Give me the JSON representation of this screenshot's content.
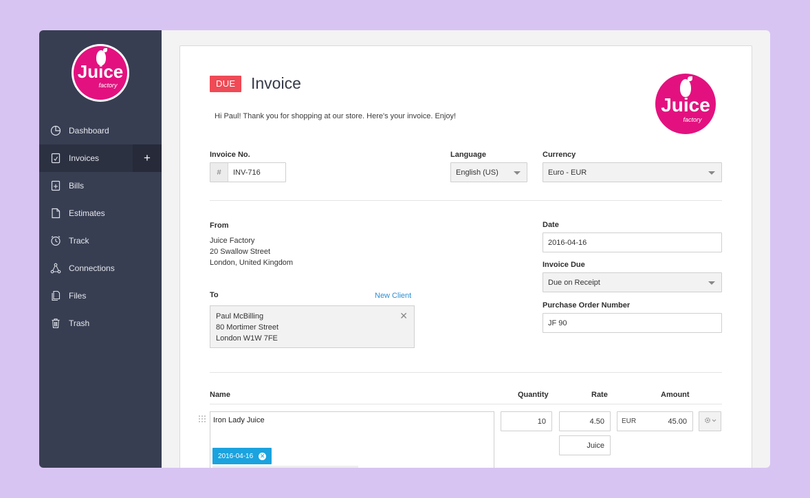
{
  "brand": {
    "logo_word": "Juice",
    "logo_sub": "factory",
    "accent": "#e3117f"
  },
  "sidebar": {
    "items": [
      {
        "label": "Dashboard",
        "icon": "pie-chart-icon"
      },
      {
        "label": "Invoices",
        "icon": "invoice-icon",
        "active": true,
        "action": "+"
      },
      {
        "label": "Bills",
        "icon": "bill-icon"
      },
      {
        "label": "Estimates",
        "icon": "document-icon"
      },
      {
        "label": "Track",
        "icon": "clock-icon"
      },
      {
        "label": "Connections",
        "icon": "connections-icon"
      },
      {
        "label": "Files",
        "icon": "files-icon"
      },
      {
        "label": "Trash",
        "icon": "trash-icon"
      }
    ]
  },
  "invoice": {
    "status": "DUE",
    "title": "Invoice",
    "greeting": "Hi Paul! Thank you for shopping at our store. Here's your invoice. Enjoy!",
    "number_label": "Invoice No.",
    "number_prefix": "#",
    "number": "INV-716",
    "language_label": "Language",
    "language": "English (US)",
    "currency_label": "Currency",
    "currency": "Euro - EUR",
    "from_label": "From",
    "from_lines": [
      "Juice Factory",
      "20 Swallow Street",
      "London, United Kingdom"
    ],
    "to_label": "To",
    "new_client": "New Client",
    "to_lines": [
      "Paul McBilling",
      "80 Mortimer Street",
      "London W1W 7FE"
    ],
    "date_label": "Date",
    "date": "2016-04-16",
    "due_label": "Invoice Due",
    "due": "Due on Receipt",
    "po_label": "Purchase Order Number",
    "po": "JF 90"
  },
  "items_table": {
    "headers": {
      "name": "Name",
      "quantity": "Quantity",
      "rate": "Rate",
      "amount": "Amount"
    },
    "rows": [
      {
        "name": "Iron Lady Juice",
        "quantity": "10",
        "rate": "4.50",
        "unit": "Juice",
        "currency": "EUR",
        "amount": "45.00",
        "date_tag": "2016-04-16"
      }
    ]
  }
}
